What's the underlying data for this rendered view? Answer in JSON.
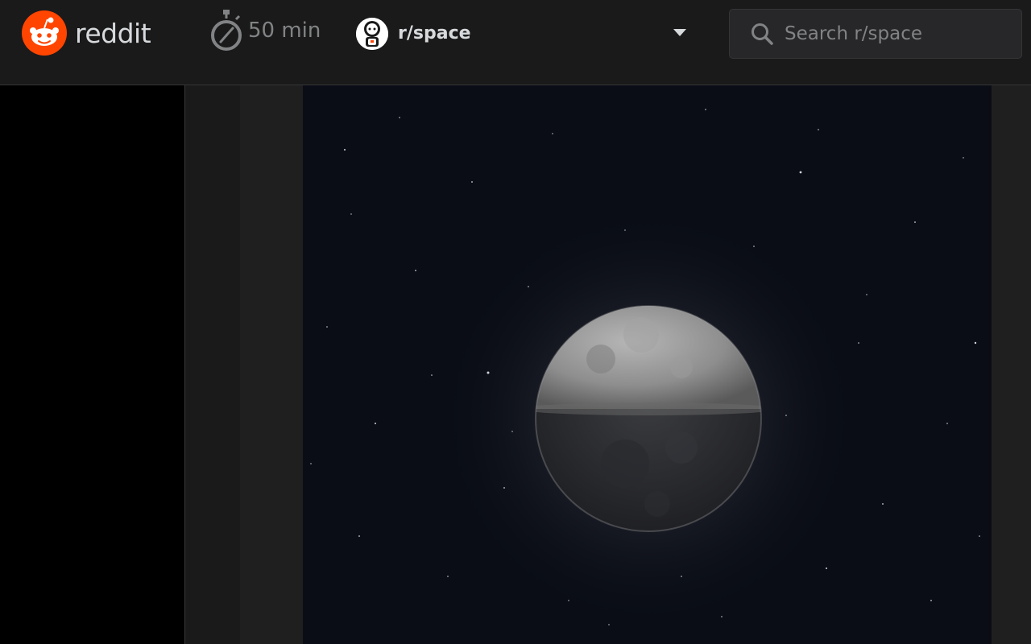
{
  "header": {
    "logo_text": "reddit",
    "timer_text": "50 min",
    "community_name": "r/space",
    "search_placeholder": "Search r/space"
  },
  "icons": {
    "logo": "reddit-snoo-icon",
    "timer": "stopwatch-icon",
    "community": "astronaut-snoo-avatar",
    "dropdown": "caret-down-icon",
    "search": "search-icon"
  },
  "colors": {
    "brand": "#ff4500",
    "header_bg": "#1a1a1b",
    "text": "#d7dadc",
    "muted": "#818384"
  },
  "post": {
    "image_subject": "moon"
  }
}
